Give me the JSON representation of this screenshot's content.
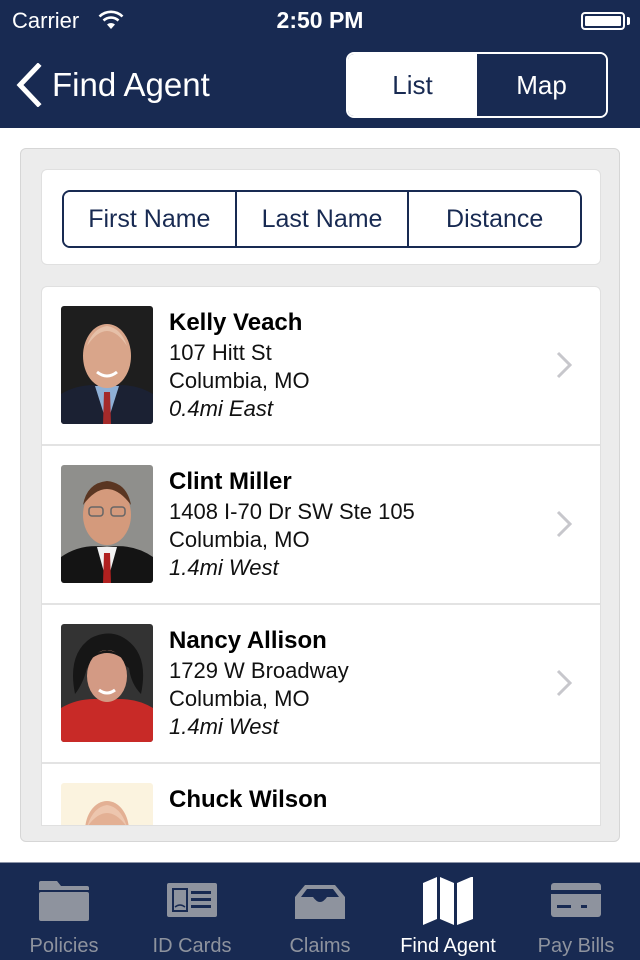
{
  "status_bar": {
    "carrier": "Carrier",
    "time": "2:50 PM",
    "wifi_icon": "wifi-icon",
    "battery_icon": "battery-icon"
  },
  "nav": {
    "back_label": "Find Agent",
    "back_icon": "chevron-left-icon",
    "view_toggle": [
      {
        "label": "List",
        "selected": true
      },
      {
        "label": "Map",
        "selected": false
      }
    ]
  },
  "sort": {
    "options": [
      {
        "label": "First Name"
      },
      {
        "label": "Last Name"
      },
      {
        "label": "Distance"
      }
    ]
  },
  "agents": [
    {
      "name": "Kelly Veach",
      "address": "107 Hitt St",
      "city": "Columbia, MO",
      "distance": "0.4mi East"
    },
    {
      "name": "Clint Miller",
      "address": "1408 I-70 Dr SW Ste 105",
      "city": "Columbia, MO",
      "distance": "1.4mi West"
    },
    {
      "name": "Nancy Allison",
      "address": "1729 W Broadway",
      "city": "Columbia, MO",
      "distance": "1.4mi West"
    },
    {
      "name": "Chuck Wilson",
      "address": "",
      "city": "",
      "distance": ""
    }
  ],
  "tab_bar": {
    "tabs": [
      {
        "label": "Policies",
        "icon": "folder-icon",
        "active": false
      },
      {
        "label": "ID Cards",
        "icon": "id-card-icon",
        "active": false
      },
      {
        "label": "Claims",
        "icon": "inbox-tray-icon",
        "active": false
      },
      {
        "label": "Find Agent",
        "icon": "map-icon",
        "active": true
      },
      {
        "label": "Pay Bills",
        "icon": "credit-card-icon",
        "active": false
      }
    ]
  },
  "colors": {
    "brand_navy": "#182a52",
    "inactive_tab": "#8e939e",
    "panel_bg": "#ececec"
  }
}
